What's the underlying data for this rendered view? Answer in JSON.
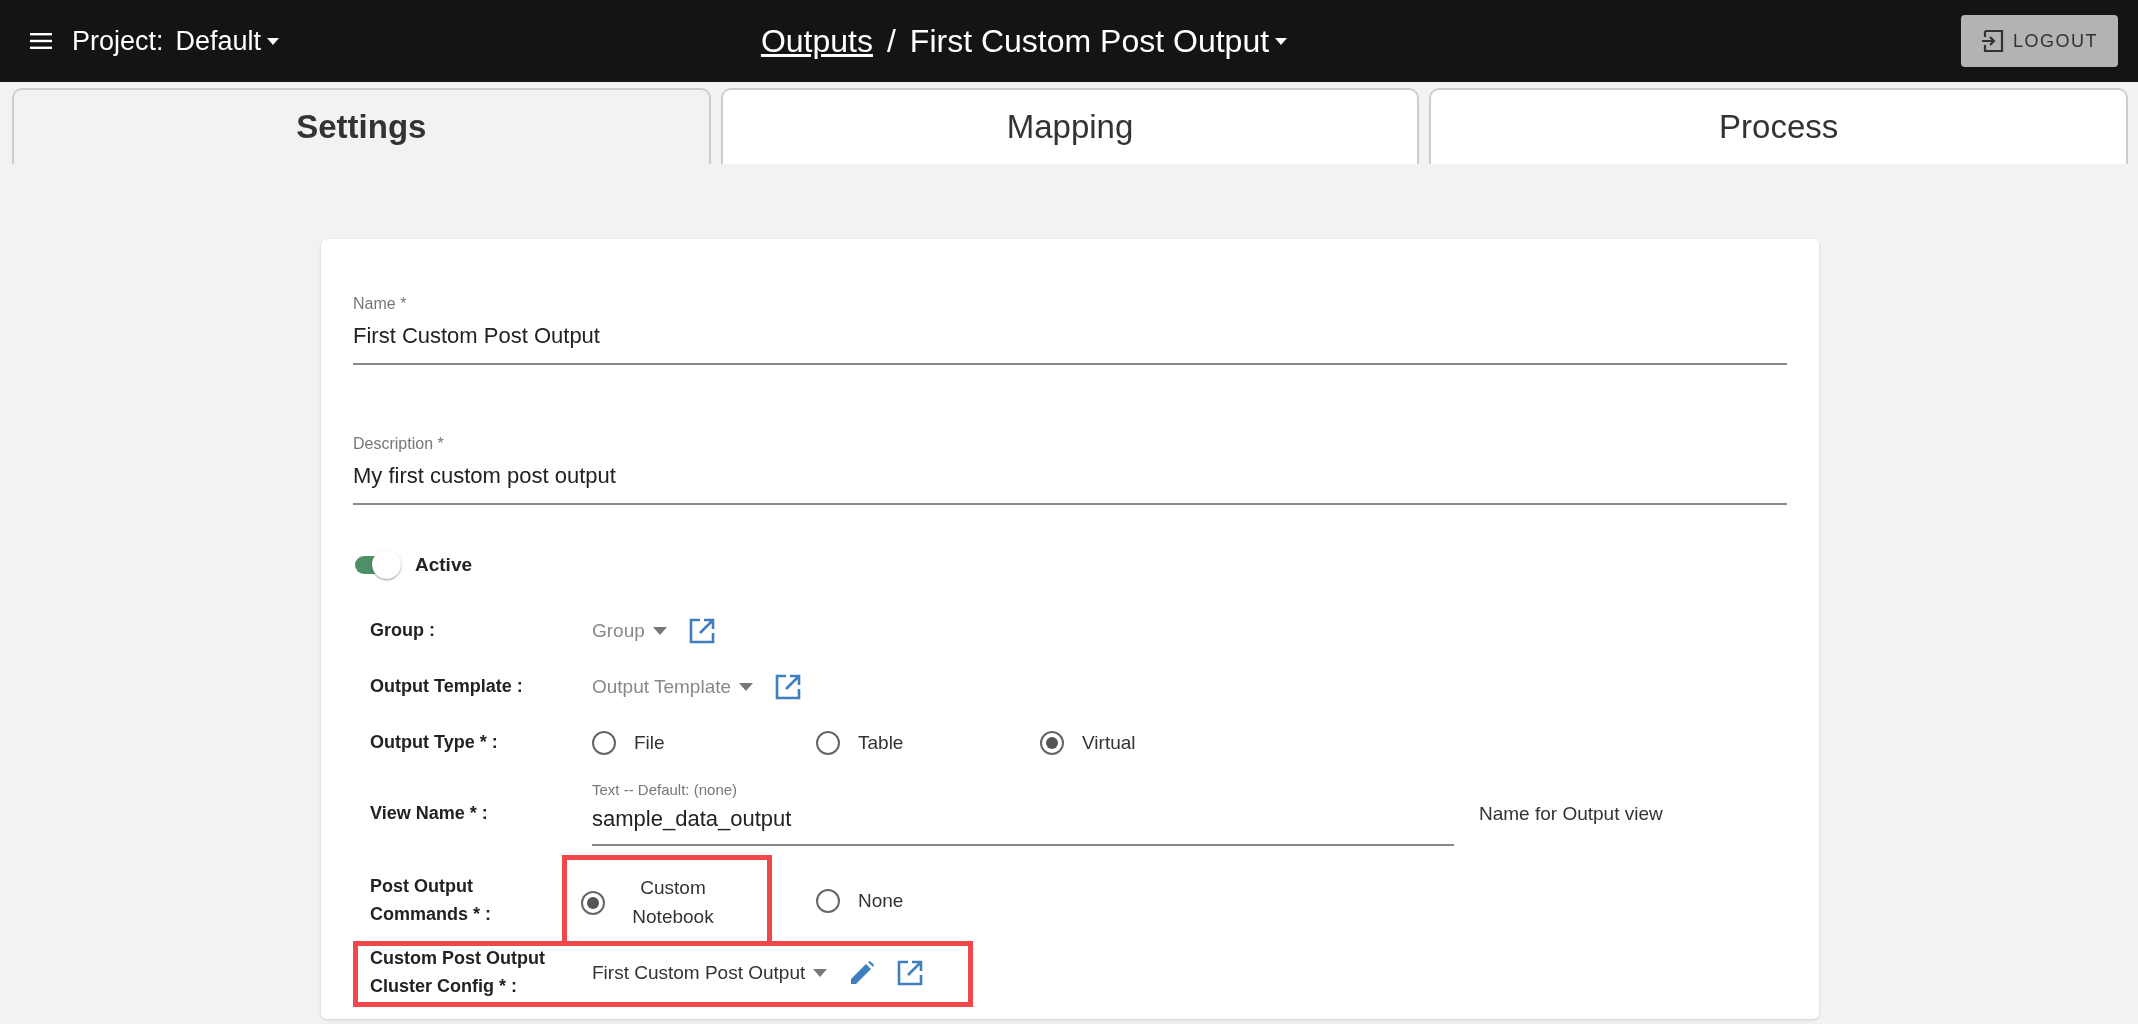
{
  "header": {
    "project_label": "Project:",
    "project_value": "Default",
    "breadcrumb_link": "Outputs",
    "separator": "/",
    "title": "First Custom Post Output",
    "logout": "LOGOUT"
  },
  "tabs": [
    {
      "label": "Settings",
      "selected": true
    },
    {
      "label": "Mapping",
      "selected": false
    },
    {
      "label": "Process",
      "selected": false
    }
  ],
  "name_field": {
    "label": "Name *",
    "value": "First Custom Post Output"
  },
  "description_field": {
    "label": "Description *",
    "value": "My first custom post output"
  },
  "active_toggle": {
    "label": "Active",
    "on": true
  },
  "rows": [
    {
      "kind": "dropdown",
      "label": "Group :",
      "placeholder": "Group",
      "highlighted": false
    },
    {
      "kind": "dropdown",
      "label": "Output Template :",
      "placeholder": "Output Template",
      "highlighted": false
    },
    {
      "kind": "radio",
      "label": "Output Type * :",
      "options": [
        {
          "label": "File",
          "selected": false
        },
        {
          "label": "Table",
          "selected": false
        },
        {
          "label": "Virtual",
          "selected": true
        }
      ],
      "highlighted": false
    },
    {
      "kind": "text",
      "label": "View Name * :",
      "helper": "Text -- Default: (none)",
      "value": "sample_data_output",
      "hint": "Name for Output view",
      "highlighted": false
    },
    {
      "kind": "radio",
      "label": "Post Output Commands * :",
      "options": [
        {
          "label": "Custom Notebook",
          "selected": true,
          "highlighted": true
        },
        {
          "label": "None",
          "selected": false,
          "highlighted": false
        }
      ],
      "highlighted": false
    },
    {
      "kind": "select",
      "label": "Custom Post Output Cluster Config * :",
      "value": "First Custom Post Output",
      "highlighted": true
    }
  ]
}
